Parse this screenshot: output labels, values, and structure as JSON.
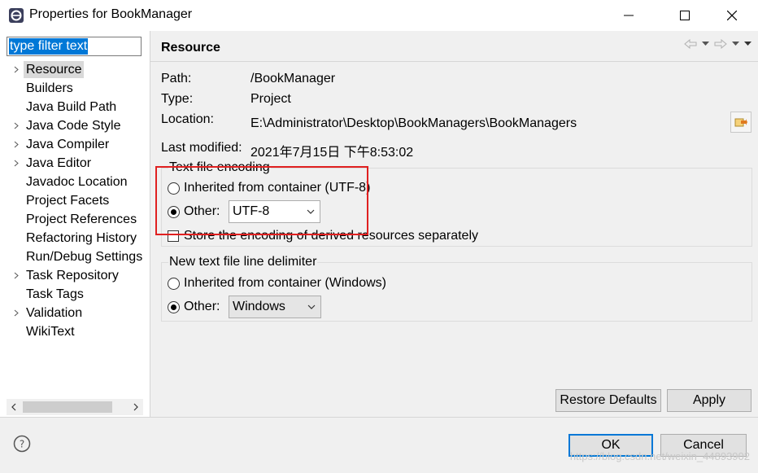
{
  "window": {
    "title": "Properties for BookManager",
    "controls": [
      "minimize-icon",
      "maximize-icon",
      "close-icon"
    ]
  },
  "left_pane": {
    "filter_value": "type filter text",
    "tree": [
      {
        "label": "Resource",
        "expandable": true,
        "selected": true
      },
      {
        "label": "Builders",
        "expandable": false
      },
      {
        "label": "Java Build Path",
        "expandable": false
      },
      {
        "label": "Java Code Style",
        "expandable": true
      },
      {
        "label": "Java Compiler",
        "expandable": true
      },
      {
        "label": "Java Editor",
        "expandable": true
      },
      {
        "label": "Javadoc Location",
        "expandable": false
      },
      {
        "label": "Project Facets",
        "expandable": false
      },
      {
        "label": "Project References",
        "expandable": false
      },
      {
        "label": "Refactoring History",
        "expandable": false
      },
      {
        "label": "Run/Debug Settings",
        "expandable": false
      },
      {
        "label": "Task Repository",
        "expandable": true
      },
      {
        "label": "Task Tags",
        "expandable": false
      },
      {
        "label": "Validation",
        "expandable": true
      },
      {
        "label": "WikiText",
        "expandable": false
      }
    ]
  },
  "page": {
    "title": "Resource",
    "fields": {
      "path_label": "Path:",
      "path_value": "/BookManager",
      "type_label": "Type:",
      "type_value": "Project",
      "location_label": "Location:",
      "location_value": "E:\\Administrator\\Desktop\\BookManagers\\BookManagers",
      "modified_label": "Last modified:",
      "modified_value": "2021年7月15日 下午8:53:02"
    },
    "encoding_group": {
      "title": "Text file encoding",
      "inherited_label": "Inherited from container (UTF-8)",
      "other_label": "Other:",
      "other_value": "UTF-8",
      "selected": "other",
      "store_label": "Store the encoding of derived resources separately",
      "store_checked": false
    },
    "delimiter_group": {
      "title": "New text file line delimiter",
      "inherited_label": "Inherited from container (Windows)",
      "other_label": "Other:",
      "other_value": "Windows",
      "selected": "other"
    },
    "restore_defaults_label": "Restore Defaults",
    "apply_label": "Apply"
  },
  "footer": {
    "ok_label": "OK",
    "cancel_label": "Cancel",
    "watermark": "https://blog.csdn.net/weixin_44893902"
  },
  "colors": {
    "selection": "#0078d7",
    "highlight_box": "#e02020",
    "panel_bg": "#f0f0f0"
  }
}
